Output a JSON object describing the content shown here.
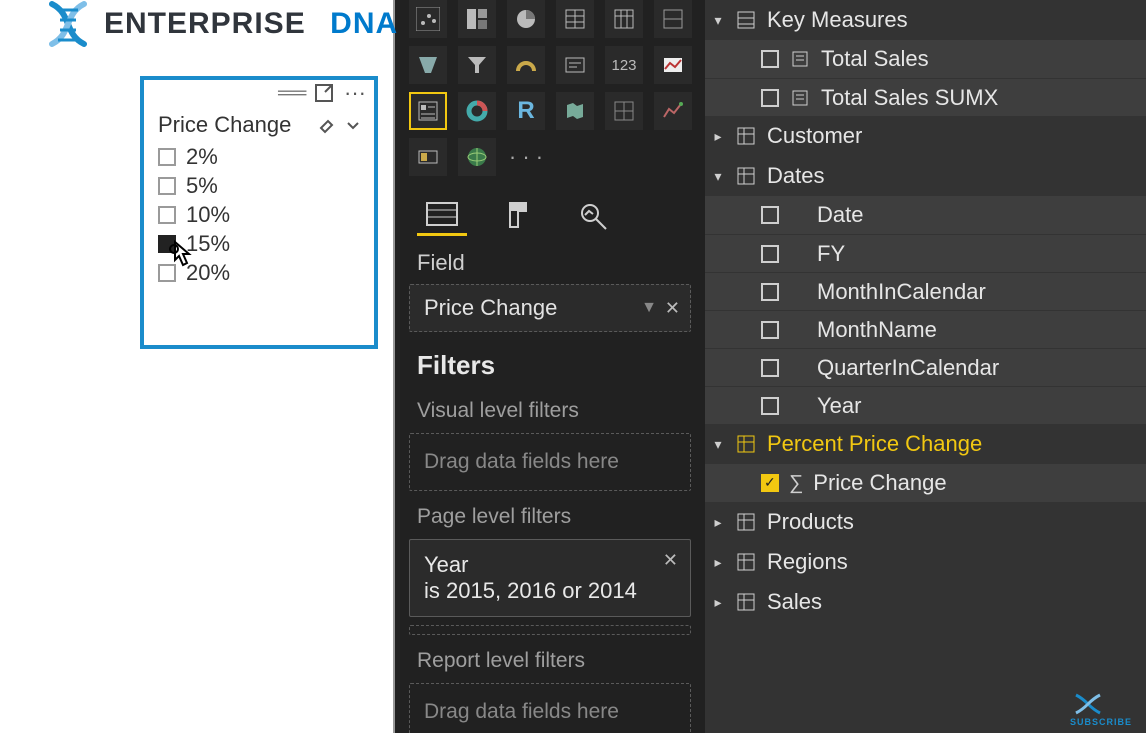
{
  "logo": {
    "part1": "ENTERPRISE",
    "part2": "DNA"
  },
  "slicer": {
    "title": "Price Change",
    "items": [
      {
        "label": "2%",
        "checked": false
      },
      {
        "label": "5%",
        "checked": false
      },
      {
        "label": "10%",
        "checked": false
      },
      {
        "label": "15%",
        "checked": true
      },
      {
        "label": "20%",
        "checked": false
      }
    ],
    "toolbar_more": "···"
  },
  "viz": {
    "field_section": "Field",
    "field_well": "Price Change",
    "filters_header": "Filters",
    "visual_level_label": "Visual level filters",
    "page_level_label": "Page level filters",
    "report_level_label": "Report level filters",
    "drag_placeholder": "Drag data fields here",
    "page_filter": {
      "title": "Year",
      "summary": "is 2015, 2016 or 2014"
    }
  },
  "fields": {
    "key_measures": {
      "label": "Key Measures",
      "children": [
        {
          "label": "Total Sales",
          "checked": false,
          "icon": "calc"
        },
        {
          "label": "Total Sales SUMX",
          "checked": false,
          "icon": "calc"
        }
      ]
    },
    "customer": {
      "label": "Customer"
    },
    "dates": {
      "label": "Dates",
      "children": [
        {
          "label": "Date",
          "checked": false
        },
        {
          "label": "FY",
          "checked": false
        },
        {
          "label": "MonthInCalendar",
          "checked": false
        },
        {
          "label": "MonthName",
          "checked": false
        },
        {
          "label": "QuarterInCalendar",
          "checked": false
        },
        {
          "label": "Year",
          "checked": false
        }
      ]
    },
    "ppc": {
      "label": "Percent Price Change",
      "children": [
        {
          "label": "Price Change",
          "checked": true,
          "icon": "sigma"
        }
      ]
    },
    "products": {
      "label": "Products"
    },
    "regions": {
      "label": "Regions"
    },
    "sales": {
      "label": "Sales"
    }
  },
  "subscribe": "SUBSCRIBE"
}
